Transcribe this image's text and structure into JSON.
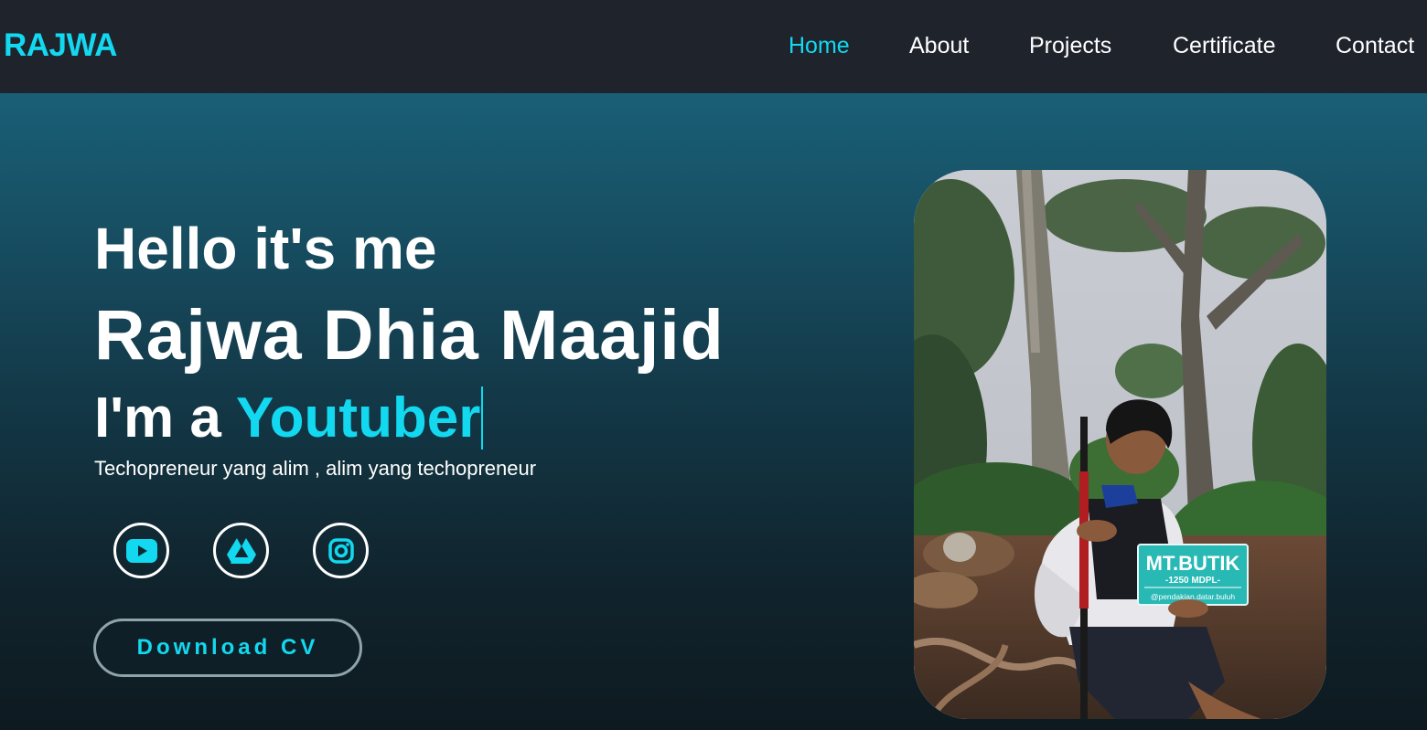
{
  "header": {
    "logo": "RAJWA",
    "nav": [
      {
        "label": "Home",
        "active": true
      },
      {
        "label": "About",
        "active": false
      },
      {
        "label": "Projects",
        "active": false
      },
      {
        "label": "Certificate",
        "active": false
      },
      {
        "label": "Contact",
        "active": false
      }
    ]
  },
  "hero": {
    "greeting": "Hello it's me",
    "name": "Rajwa Dhia Maajid",
    "role_prefix": "I'm a",
    "role_typed": "Youtuber",
    "tagline": "Techopreneur yang alim , alim yang techopreneur",
    "social": [
      {
        "icon": "youtube-icon"
      },
      {
        "icon": "google-drive-icon"
      },
      {
        "icon": "instagram-icon"
      }
    ],
    "cv_button": "Download CV"
  },
  "photo": {
    "sign_title": "MT.BUTIK",
    "sign_subtitle": "-1250 MDPL-",
    "sign_handle": "@pendakian.datar.buluh"
  },
  "colors": {
    "accent": "#12d8f0",
    "nav_bg": "#1f232c",
    "hero_top": "#195f76",
    "hero_bottom": "#0e1a20"
  }
}
